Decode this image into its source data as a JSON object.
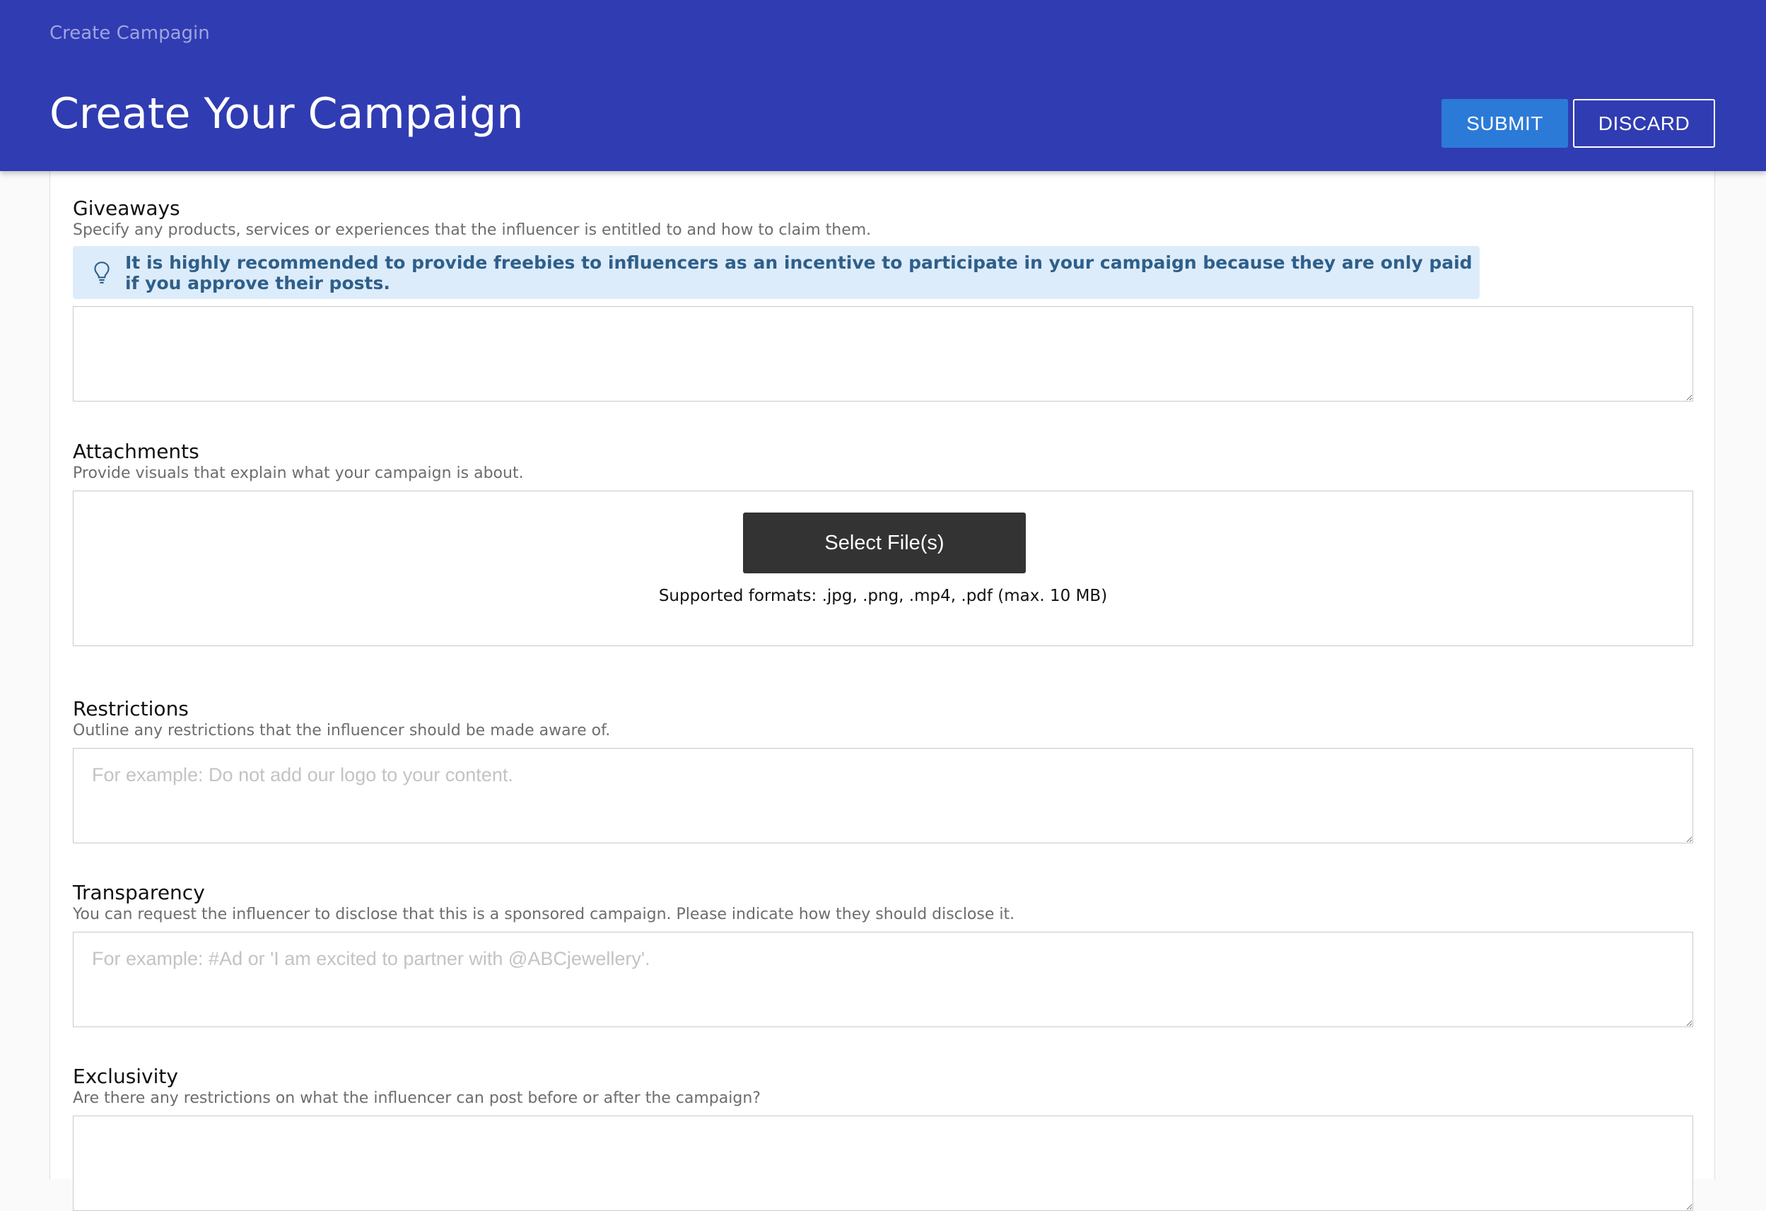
{
  "header": {
    "breadcrumb": "Create Campagin",
    "title": "Create Your Campaign",
    "submit_label": "SUBMIT",
    "discard_label": "DISCARD",
    "colors": {
      "background": "#303cb2",
      "submit": "#2b7ad8"
    }
  },
  "giveaways": {
    "title": "Giveaways",
    "description": "Specify any products, services or experiences that the influencer is entitled to and how to claim them.",
    "tip_icon": "lightbulb-icon",
    "tip": "It is highly recommended to provide freebies to influencers as an incentive to participate in your campaign because they are only paid if you approve their posts.",
    "value": "",
    "placeholder": ""
  },
  "attachments": {
    "title": "Attachments",
    "description": "Provide visuals that explain what your campaign is about.",
    "select_label": "Select File(s)",
    "formats": "Supported formats: .jpg, .png, .mp4, .pdf (max. 10 MB)"
  },
  "restrictions": {
    "title": "Restrictions",
    "description": "Outline any restrictions that the influencer should be made aware of.",
    "placeholder": "For example: Do not add our logo to your content.",
    "value": ""
  },
  "transparency": {
    "title": "Transparency",
    "description": "You can request the influencer to disclose that this is a sponsored campaign. Please indicate how they should disclose it.",
    "placeholder": "For example: #Ad or 'I am excited to partner with @ABCjewellery'.",
    "value": ""
  },
  "exclusivity": {
    "title": "Exclusivity",
    "description": "Are there any restrictions on what the influencer can post before or after the campaign?",
    "placeholder": "",
    "value": ""
  }
}
